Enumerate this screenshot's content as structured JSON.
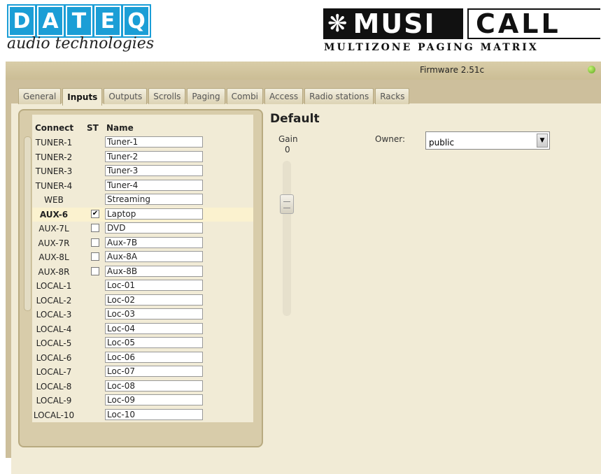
{
  "brand": {
    "logo_letters": [
      "D",
      "A",
      "T",
      "E",
      "Q"
    ],
    "tagline": "audio technologies",
    "product_part1": "MUSI",
    "product_part2": "CALL",
    "subtitle": "MULTIZONE PAGING MATRIX",
    "accent_color": "#1b9ed6"
  },
  "status": {
    "firmware": "Firmware 2.51c",
    "indicator": "online-led",
    "indicator_color": "#5aa51a"
  },
  "tabs": [
    {
      "label": "General",
      "active": false
    },
    {
      "label": "Inputs",
      "active": true
    },
    {
      "label": "Outputs",
      "active": false
    },
    {
      "label": "Scrolls",
      "active": false
    },
    {
      "label": "Paging",
      "active": false
    },
    {
      "label": "Combi",
      "active": false
    },
    {
      "label": "Access",
      "active": false
    },
    {
      "label": "Radio stations",
      "active": false
    },
    {
      "label": "Racks",
      "active": false
    }
  ],
  "inputs": {
    "headers": {
      "connect": "Connect",
      "st": "ST",
      "name": "Name"
    },
    "rows": [
      {
        "connect": "TUNER-1",
        "st": null,
        "name": "Tuner-1"
      },
      {
        "connect": "TUNER-2",
        "st": null,
        "name": "Tuner-2"
      },
      {
        "connect": "TUNER-3",
        "st": null,
        "name": "Tuner-3"
      },
      {
        "connect": "TUNER-4",
        "st": null,
        "name": "Tuner-4"
      },
      {
        "connect": "WEB",
        "st": null,
        "name": "Streaming"
      },
      {
        "connect": "AUX-6",
        "st": true,
        "name": "Laptop",
        "selected": true
      },
      {
        "connect": "AUX-7L",
        "st": false,
        "name": "DVD"
      },
      {
        "connect": "AUX-7R",
        "st": false,
        "name": "Aux-7B"
      },
      {
        "connect": "AUX-8L",
        "st": false,
        "name": "Aux-8A"
      },
      {
        "connect": "AUX-8R",
        "st": false,
        "name": "Aux-8B"
      },
      {
        "connect": "LOCAL-1",
        "st": null,
        "name": "Loc-01"
      },
      {
        "connect": "LOCAL-2",
        "st": null,
        "name": "Loc-02"
      },
      {
        "connect": "LOCAL-3",
        "st": null,
        "name": "Loc-03"
      },
      {
        "connect": "LOCAL-4",
        "st": null,
        "name": "Loc-04"
      },
      {
        "connect": "LOCAL-5",
        "st": null,
        "name": "Loc-05"
      },
      {
        "connect": "LOCAL-6",
        "st": null,
        "name": "Loc-06"
      },
      {
        "connect": "LOCAL-7",
        "st": null,
        "name": "Loc-07"
      },
      {
        "connect": "LOCAL-8",
        "st": null,
        "name": "Loc-08"
      },
      {
        "connect": "LOCAL-9",
        "st": null,
        "name": "Loc-09"
      },
      {
        "connect": "LOCAL-10",
        "st": null,
        "name": "Loc-10"
      }
    ]
  },
  "detail": {
    "title": "Default",
    "gain_label": "Gain",
    "gain_value": "0",
    "owner_label": "Owner:",
    "owner_value": "public"
  }
}
